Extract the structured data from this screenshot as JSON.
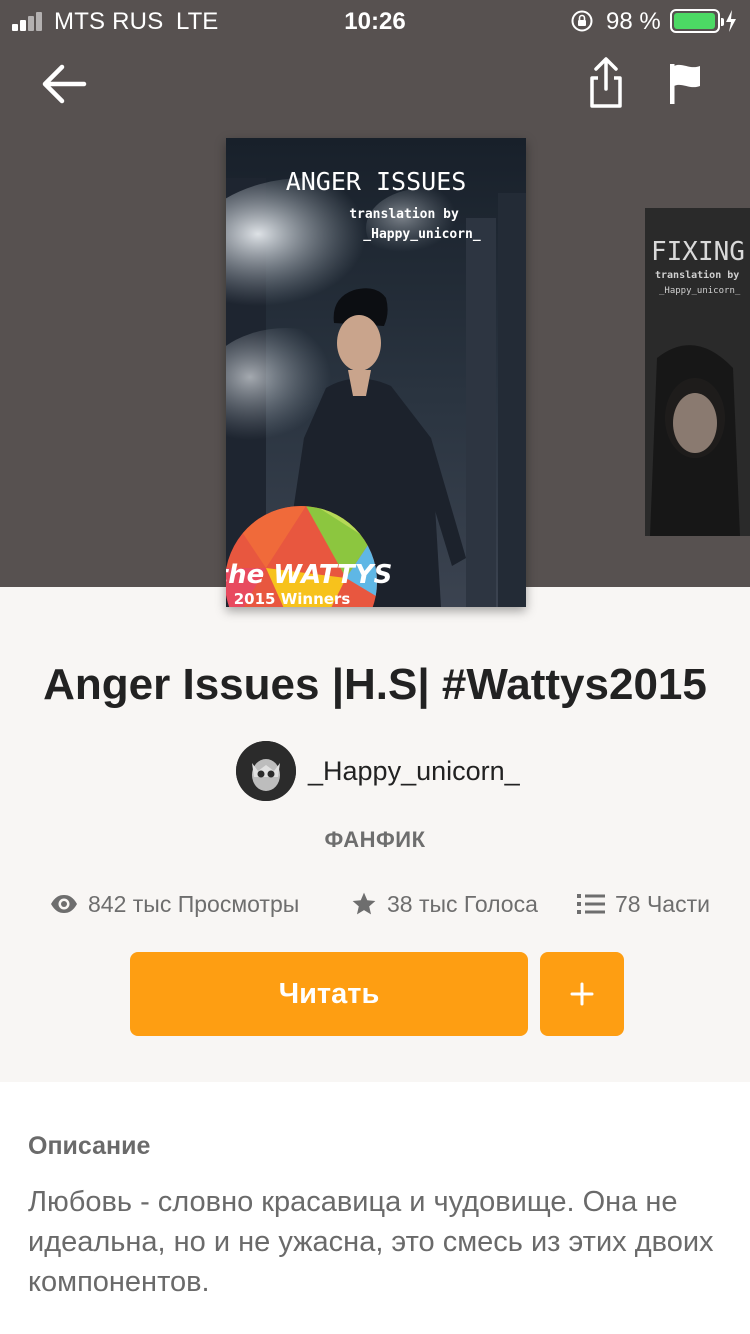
{
  "status_bar": {
    "carrier": "MTS RUS",
    "network": "LTE",
    "time": "10:26",
    "battery_percent": "98 %",
    "battery_level": 0.98,
    "colors": {
      "battery_fill": "#4cd964"
    }
  },
  "toolbar": {
    "back_icon": "arrow-left-icon",
    "share_icon": "share-icon",
    "report_icon": "flag-icon"
  },
  "covers": {
    "main": {
      "title": "ANGER ISSUES",
      "subtitle_line1": "translation by",
      "subtitle_line2": "_Happy_unicorn_",
      "badge_brand": "the WATTYS",
      "badge_caption": "2015 Winners"
    },
    "next": {
      "title": "FIXING S",
      "subtitle_line1": "translation by",
      "subtitle_line2": "_Happy_unicorn_"
    }
  },
  "story": {
    "title": "Anger Issues |H.S| #Wattys2015",
    "author": "_Happy_unicorn_",
    "category": "ФАНФИК"
  },
  "stats": {
    "views": "842 тыс Просмотры",
    "votes": "38 тыс Голоса",
    "parts": "78 Части"
  },
  "actions": {
    "read_label": "Читать",
    "add_icon": "plus-icon"
  },
  "description": {
    "heading": "Описание",
    "text": "Любовь - словно красавица и чудовище. Она не идеальна, но и не ужасна, это смесь из этих двоих компонентов."
  },
  "colors": {
    "hero_background": "#575150",
    "accent": "#fe9e12",
    "page_background": "#f8f6f4"
  }
}
